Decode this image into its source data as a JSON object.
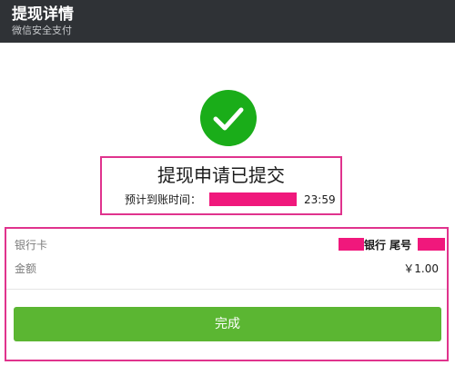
{
  "header": {
    "title": "提现详情",
    "subtitle": "微信安全支付"
  },
  "status": {
    "icon": "check-circle-icon",
    "title": "提现申请已提交",
    "eta_label": "预计到账时间：",
    "eta_time": "23:59"
  },
  "details": {
    "bank_label": "银行卡",
    "bank_value": "银行 尾号",
    "amount_label": "金额",
    "amount_value": "￥1.00"
  },
  "actions": {
    "done_label": "完成"
  },
  "colors": {
    "topbar": "#2f3236",
    "success_green": "#1aad19",
    "button_green": "#5bb632",
    "highlight_border": "#e0338d",
    "redaction": "#f0187c"
  }
}
